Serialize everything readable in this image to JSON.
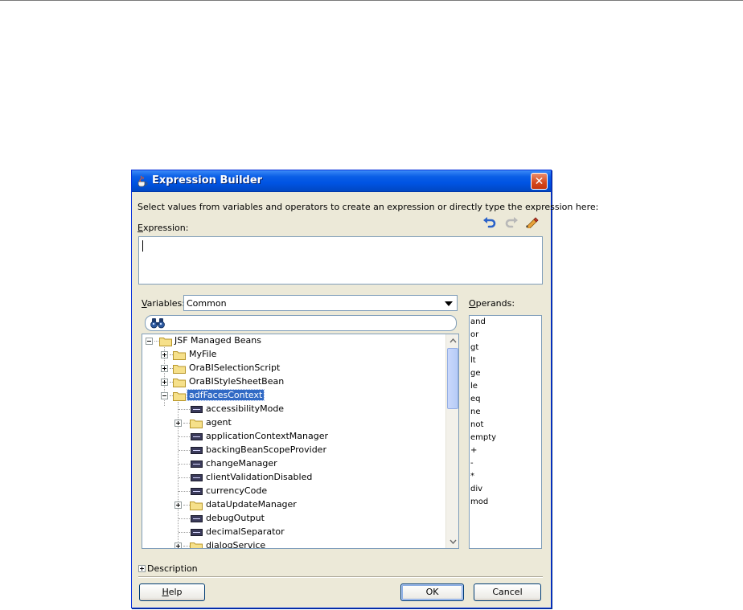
{
  "window": {
    "title": "Expression Builder",
    "close_glyph": "✕"
  },
  "instruction": "Select values from variables and operators to create an expression or directly type the expression here:",
  "expression": {
    "label_accel": "E",
    "label_rest": "xpression:",
    "value": ""
  },
  "toolbar": {
    "icons": [
      "undo-icon",
      "redo-icon",
      "clear-icon"
    ]
  },
  "variables": {
    "label_accel": "V",
    "label_rest": "ariables:",
    "selected": "Common"
  },
  "tree": {
    "items": [
      {
        "label": "JSF Managed Beans",
        "type": "folder",
        "state": "expanded"
      },
      {
        "label": "MyFile",
        "type": "folder",
        "state": "collapsed"
      },
      {
        "label": "OraBISelectionScript",
        "type": "folder",
        "state": "collapsed"
      },
      {
        "label": "OraBIStyleSheetBean",
        "type": "folder",
        "state": "collapsed"
      },
      {
        "label": "adfFacesContext",
        "type": "folder",
        "state": "expanded",
        "selected": true
      },
      {
        "label": "accessibilityMode",
        "type": "property"
      },
      {
        "label": "agent",
        "type": "folder",
        "state": "collapsed"
      },
      {
        "label": "applicationContextManager",
        "type": "property"
      },
      {
        "label": "backingBeanScopeProvider",
        "type": "property"
      },
      {
        "label": "changeManager",
        "type": "property"
      },
      {
        "label": "clientValidationDisabled",
        "type": "property"
      },
      {
        "label": "currencyCode",
        "type": "property"
      },
      {
        "label": "dataUpdateManager",
        "type": "folder",
        "state": "collapsed"
      },
      {
        "label": "debugOutput",
        "type": "property"
      },
      {
        "label": "decimalSeparator",
        "type": "property"
      },
      {
        "label": "dialogService",
        "type": "folder",
        "state": "collapsed"
      }
    ]
  },
  "operands": {
    "label_accel": "O",
    "label_rest": "perands:",
    "items": [
      "and",
      "or",
      "gt",
      "lt",
      "ge",
      "le",
      "eq",
      "ne",
      "not",
      "empty",
      "+",
      "-",
      "*",
      "div",
      "mod"
    ]
  },
  "description": {
    "label": "Description"
  },
  "buttons": {
    "help_accel": "H",
    "help_rest": "elp",
    "ok": "OK",
    "cancel": "Cancel"
  }
}
